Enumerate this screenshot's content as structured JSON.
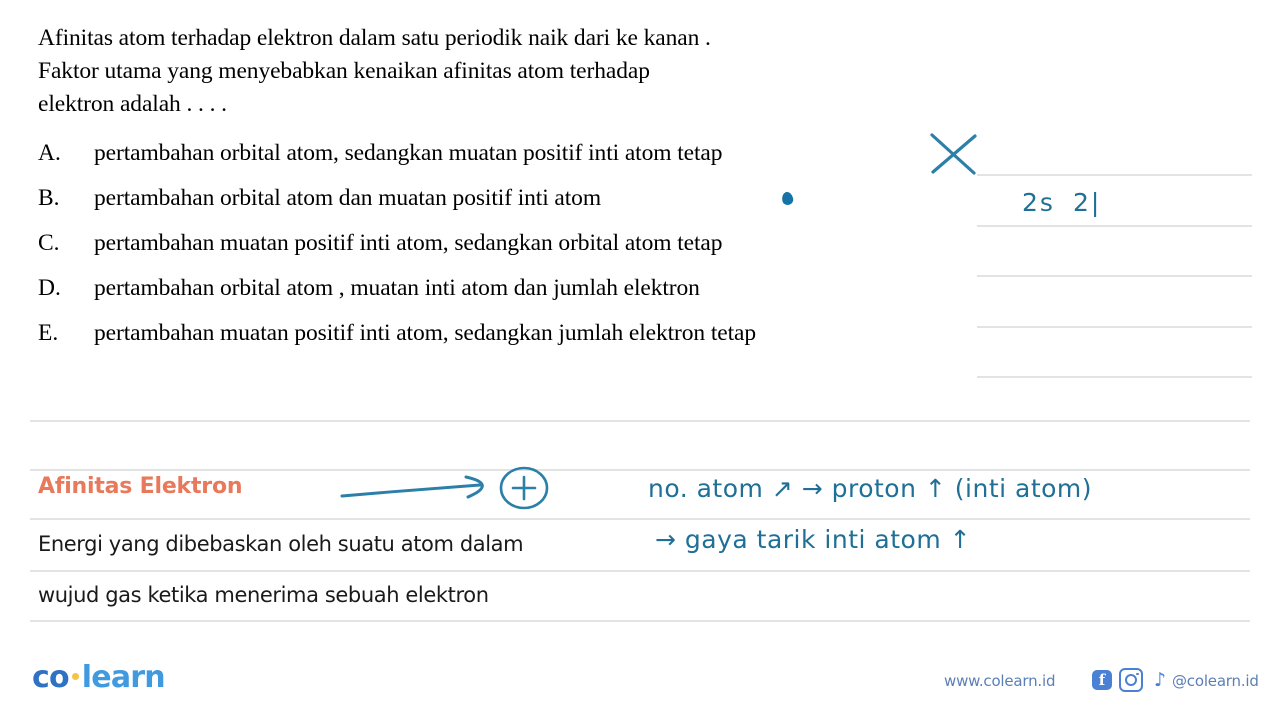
{
  "question": {
    "line1": "Afinitas atom terhadap elektron dalam satu periodik naik  dari ke kanan .",
    "line2": "Faktor utama yang menyebabkan kenaikan afinitas atom terhadap",
    "line3": "elektron adalah . . . ."
  },
  "options": [
    {
      "letter": "A.",
      "text": "pertambahan orbital atom, sedangkan muatan positif inti atom tetap"
    },
    {
      "letter": "B.",
      "text": "pertambahan orbital atom dan muatan positif inti atom"
    },
    {
      "letter": "C.",
      "text": "pertambahan muatan positif inti atom, sedangkan orbital atom tetap"
    },
    {
      "letter": "D.",
      "text": "pertambahan orbital atom , muatan  inti atom dan jumlah elektron"
    },
    {
      "letter": "E.",
      "text": "pertambahan muatan positif inti atom, sedangkan jumlah elektron tetap"
    }
  ],
  "annotations": {
    "cross_mark": "x-mark",
    "selected_dot": "selected-dot",
    "notepad_note": "2s",
    "notepad_note2": "2|",
    "arrow_plus": "+",
    "hand_note_1": "no. atom ↗ → proton ↑ (inti atom)",
    "hand_note_2": "→ gaya tarik inti atom ↑"
  },
  "glossary": {
    "title": "Afinitas Elektron",
    "definition_line1": "Energi yang dibebaskan oleh suatu atom dalam",
    "definition_line2": "wujud gas ketika menerima sebuah elektron"
  },
  "footer": {
    "logo_part1": "co",
    "logo_part2": "learn",
    "website": "www.colearn.id",
    "handle": "@colearn.id",
    "facebook_icon": "facebook-icon",
    "instagram_icon": "instagram-icon",
    "tiktok_icon": "tiktok-icon",
    "tiktok_glyph": "♪"
  },
  "colors": {
    "accent_orange": "#e8795a",
    "ink_blue": "#1f6f96",
    "logo_blue": "#2f72c4",
    "rule_gray": "#e2e3e5"
  }
}
